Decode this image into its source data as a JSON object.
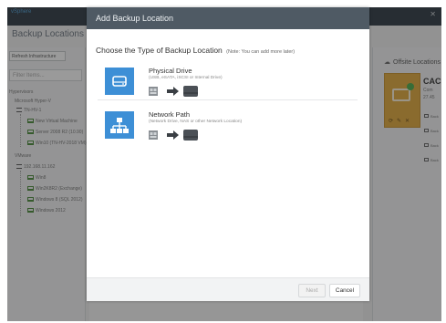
{
  "background": {
    "brand": "vSphere",
    "heading": "Backup Locations",
    "refresh_label": "Refresh Infrastructure",
    "filter_placeholder": "Filter Items...",
    "tree": {
      "groups": [
        {
          "label": "Hypervisors"
        },
        {
          "label": "Microsoft Hyper-V"
        },
        {
          "label": "TN-HV-1"
        },
        {
          "label": "New Virtual Machine"
        },
        {
          "label": "Server 2008 R2 (10.90)"
        },
        {
          "label": "Win10 (TN-HV-2018 VM)"
        },
        {
          "label": "VMware"
        },
        {
          "label": "192.168.11.162"
        },
        {
          "label": "Win8"
        },
        {
          "label": "Win2K8R2 (Exchange)"
        },
        {
          "label": "Windows 8 (SQL 2012)"
        },
        {
          "label": "Windows 2012"
        }
      ]
    },
    "offsite": {
      "title": "Offsite Locations",
      "card_name": "CAC",
      "card_sub1": "Com",
      "card_sub2": "27.45",
      "items": [
        "Back",
        "Back",
        "Back",
        "Back"
      ]
    }
  },
  "modal": {
    "title": "Add Backup Location",
    "prompt": "Choose the Type of Backup Location",
    "prompt_note": "(Note: You can add more later)",
    "options": [
      {
        "title": "Physical Drive",
        "description": "(USB, eSATA, iSCSI or Internal Drive)",
        "icon": "hard-drive-icon"
      },
      {
        "title": "Network Path",
        "description": "(Network Drive, NAS or other Network Location)",
        "icon": "network-icon"
      }
    ],
    "next_label": "Next",
    "cancel_label": "Cancel"
  },
  "colors": {
    "header": "#4f5a64",
    "accent": "#3d8fd6",
    "offsite_card": "#e2a93b"
  }
}
